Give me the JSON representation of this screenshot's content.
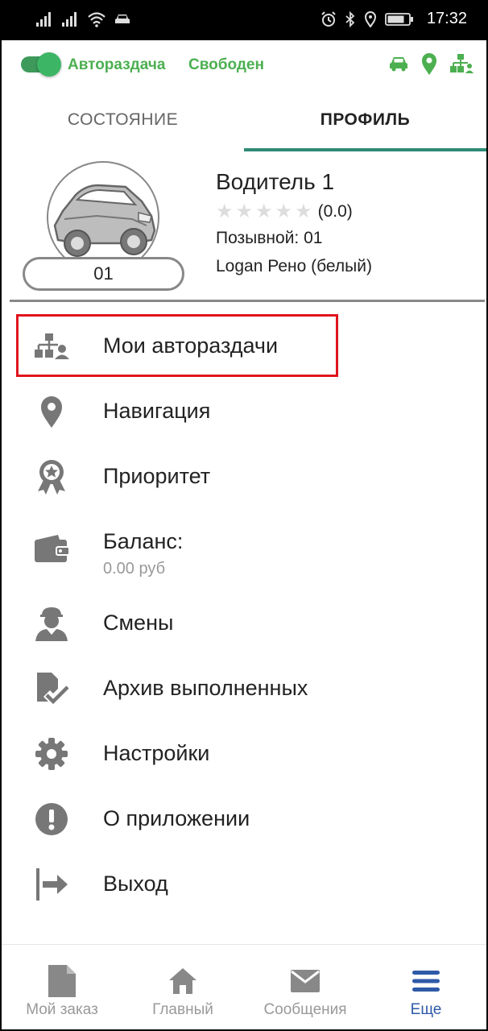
{
  "status_bar": {
    "time": "17:32"
  },
  "top_bar": {
    "auto_label": "Автораздача",
    "status_label": "Свободен",
    "accent_color": "#4caf50"
  },
  "tabs": [
    {
      "label": "СОСТОЯНИЕ",
      "active": false
    },
    {
      "label": "ПРОФИЛЬ",
      "active": true
    }
  ],
  "profile": {
    "name": "Водитель 1",
    "rating": "(0.0)",
    "stars_total": 5,
    "callsign_line": "Позывной: 01",
    "car": "Logan Рено (белый)",
    "callsign_badge": "01"
  },
  "menu": [
    {
      "label": "Мои автораздачи",
      "icon": "auto-distribution-icon"
    },
    {
      "label": "Навигация",
      "icon": "location-pin-icon"
    },
    {
      "label": "Приоритет",
      "icon": "award-icon"
    },
    {
      "label": "Баланс:",
      "sub": "0.00 руб",
      "icon": "wallet-icon"
    },
    {
      "label": "Смены",
      "icon": "driver-icon"
    },
    {
      "label": "Архив выполненных",
      "icon": "archive-done-icon"
    },
    {
      "label": "Настройки",
      "icon": "gear-icon"
    },
    {
      "label": "О приложении",
      "icon": "info-exclamation-icon"
    },
    {
      "label": "Выход",
      "icon": "logout-icon"
    }
  ],
  "bottom_nav": [
    {
      "label": "Мой заказ",
      "icon": "document-icon",
      "active": false
    },
    {
      "label": "Главный",
      "icon": "home-icon",
      "active": false
    },
    {
      "label": "Сообщения",
      "icon": "mail-icon",
      "active": false
    },
    {
      "label": "Еще",
      "icon": "menu-icon",
      "active": true
    }
  ],
  "colors": {
    "highlight": "#e0141e",
    "tab_indicator": "#2e8b76",
    "active_nav": "#2e5aa8",
    "icon_gray": "#777777"
  }
}
